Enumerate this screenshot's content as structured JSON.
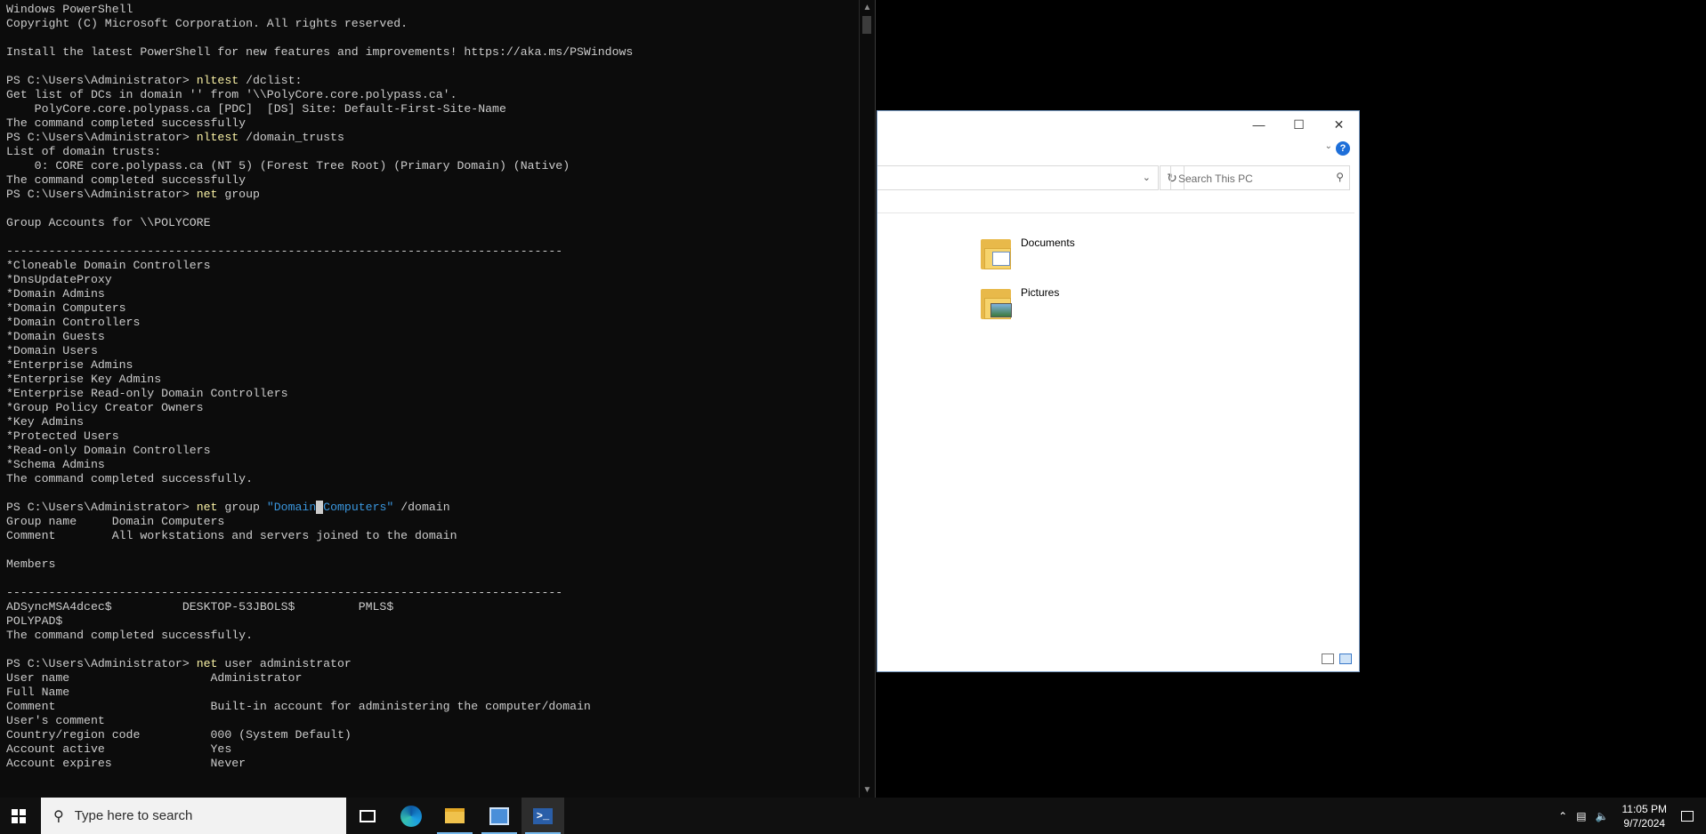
{
  "console": {
    "lines": [
      [
        {
          "t": "Windows PowerShell"
        }
      ],
      [
        {
          "t": "Copyright (C) Microsoft Corporation. All rights reserved."
        }
      ],
      [
        {
          "t": ""
        }
      ],
      [
        {
          "t": "Install the latest PowerShell for new features and improvements! https://aka.ms/PSWindows"
        }
      ],
      [
        {
          "t": ""
        }
      ],
      [
        {
          "t": "PS C:\\Users\\Administrator> "
        },
        {
          "t": "nltest",
          "c": "cmd"
        },
        {
          "t": " /dclist:"
        }
      ],
      [
        {
          "t": "Get list of DCs in domain '' from '\\\\PolyCore.core.polypass.ca'."
        }
      ],
      [
        {
          "t": "    PolyCore.core.polypass.ca [PDC]  [DS] Site: Default-First-Site-Name"
        }
      ],
      [
        {
          "t": "The command completed successfully"
        }
      ],
      [
        {
          "t": "PS C:\\Users\\Administrator> "
        },
        {
          "t": "nltest",
          "c": "cmd"
        },
        {
          "t": " /domain_trusts"
        }
      ],
      [
        {
          "t": "List of domain trusts:"
        }
      ],
      [
        {
          "t": "    0: CORE core.polypass.ca (NT 5) (Forest Tree Root) (Primary Domain) (Native)"
        }
      ],
      [
        {
          "t": "The command completed successfully"
        }
      ],
      [
        {
          "t": "PS C:\\Users\\Administrator> "
        },
        {
          "t": "net",
          "c": "cmd"
        },
        {
          "t": " group"
        }
      ],
      [
        {
          "t": ""
        }
      ],
      [
        {
          "t": "Group Accounts for \\\\POLYCORE"
        }
      ],
      [
        {
          "t": ""
        }
      ],
      [
        {
          "t": "-------------------------------------------------------------------------------"
        }
      ],
      [
        {
          "t": "*Cloneable Domain Controllers"
        }
      ],
      [
        {
          "t": "*DnsUpdateProxy"
        }
      ],
      [
        {
          "t": "*Domain Admins"
        }
      ],
      [
        {
          "t": "*Domain Computers"
        }
      ],
      [
        {
          "t": "*Domain Controllers"
        }
      ],
      [
        {
          "t": "*Domain Guests"
        }
      ],
      [
        {
          "t": "*Domain Users"
        }
      ],
      [
        {
          "t": "*Enterprise Admins"
        }
      ],
      [
        {
          "t": "*Enterprise Key Admins"
        }
      ],
      [
        {
          "t": "*Enterprise Read-only Domain Controllers"
        }
      ],
      [
        {
          "t": "*Group Policy Creator Owners"
        }
      ],
      [
        {
          "t": "*Key Admins"
        }
      ],
      [
        {
          "t": "*Protected Users"
        }
      ],
      [
        {
          "t": "*Read-only Domain Controllers"
        }
      ],
      [
        {
          "t": "*Schema Admins"
        }
      ],
      [
        {
          "t": "The command completed successfully."
        }
      ],
      [
        {
          "t": ""
        }
      ],
      [
        {
          "t": "PS C:\\Users\\Administrator> "
        },
        {
          "t": "net",
          "c": "cmd"
        },
        {
          "t": " group "
        },
        {
          "t": "\"Domain",
          "c": "str"
        },
        {
          "t": " ",
          "c": "cursor"
        },
        {
          "t": "Computers\"",
          "c": "str"
        },
        {
          "t": " /domain"
        }
      ],
      [
        {
          "t": "Group name     Domain Computers"
        }
      ],
      [
        {
          "t": "Comment        All workstations and servers joined to the domain"
        }
      ],
      [
        {
          "t": ""
        }
      ],
      [
        {
          "t": "Members"
        }
      ],
      [
        {
          "t": ""
        }
      ],
      [
        {
          "t": "-------------------------------------------------------------------------------"
        }
      ],
      [
        {
          "t": "ADSyncMSA4dcec$          DESKTOP-53JBOLS$         PMLS$"
        }
      ],
      [
        {
          "t": "POLYPAD$"
        }
      ],
      [
        {
          "t": "The command completed successfully."
        }
      ],
      [
        {
          "t": ""
        }
      ],
      [
        {
          "t": "PS C:\\Users\\Administrator> "
        },
        {
          "t": "net",
          "c": "cmd"
        },
        {
          "t": " user administrator"
        }
      ],
      [
        {
          "t": "User name                    Administrator"
        }
      ],
      [
        {
          "t": "Full Name"
        }
      ],
      [
        {
          "t": "Comment                      Built-in account for administering the computer/domain"
        }
      ],
      [
        {
          "t": "User's comment"
        }
      ],
      [
        {
          "t": "Country/region code          000 (System Default)"
        }
      ],
      [
        {
          "t": "Account active               Yes"
        }
      ],
      [
        {
          "t": "Account expires              Never"
        }
      ]
    ]
  },
  "explorer": {
    "search_placeholder": "Search This PC",
    "folders": [
      {
        "label": "Documents",
        "icon": "documents-folder-icon"
      },
      {
        "label": "Pictures",
        "icon": "pictures-folder-icon"
      }
    ]
  },
  "taskbar": {
    "search_placeholder": "Type here to search",
    "time": "11:05 PM",
    "date": "9/7/2024"
  },
  "colors": {
    "console_bg": "#0c0c0c",
    "console_fg": "#cccccc",
    "command": "#f9f1a5",
    "string": "#3a96dd",
    "taskbar": "#101010"
  }
}
